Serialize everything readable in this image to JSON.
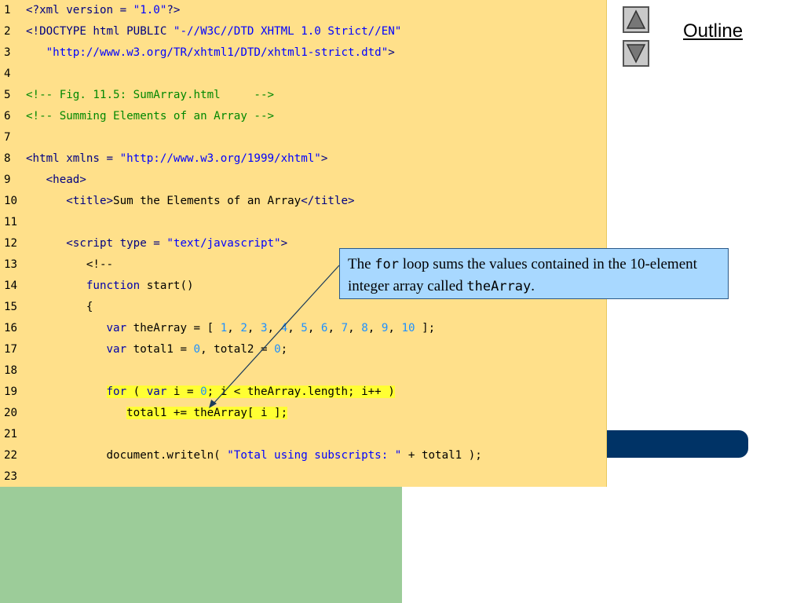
{
  "nav": {
    "outline_label": "Outline",
    "prev_icon": "triangle-up-icon",
    "next_icon": "triangle-down-icon"
  },
  "callout": {
    "part1": "The ",
    "code1": "for",
    "part2": " loop sums the values contained in the 10-element integer array called ",
    "code2": "theArray",
    "part3": "."
  },
  "code_lines": [
    {
      "num": "1",
      "text": "<?xml version = \"1.0\"?>"
    },
    {
      "num": "2",
      "text": "<!DOCTYPE html PUBLIC \"-//W3C//DTD XHTML 1.0 Strict//EN\""
    },
    {
      "num": "3",
      "text": "   \"http://www.w3.org/TR/xhtml1/DTD/xhtml1-strict.dtd\">"
    },
    {
      "num": "4",
      "text": ""
    },
    {
      "num": "5",
      "text": "<!-- Fig. 11.5: SumArray.html     -->"
    },
    {
      "num": "6",
      "text": "<!-- Summing Elements of an Array -->"
    },
    {
      "num": "7",
      "text": ""
    },
    {
      "num": "8",
      "text": "<html xmlns = \"http://www.w3.org/1999/xhtml\">"
    },
    {
      "num": "9",
      "text": "   <head>"
    },
    {
      "num": "10",
      "text": "      <title>Sum the Elements of an Array</title>"
    },
    {
      "num": "11",
      "text": ""
    },
    {
      "num": "12",
      "text": "      <script type = \"text/javascript\">"
    },
    {
      "num": "13",
      "text": "         <!--"
    },
    {
      "num": "14",
      "text": "         function start()"
    },
    {
      "num": "15",
      "text": "         {"
    },
    {
      "num": "16",
      "text": "            var theArray = [ 1, 2, 3, 4, 5, 6, 7, 8, 9, 10 ];"
    },
    {
      "num": "17",
      "text": "            var total1 = 0, total2 = 0;"
    },
    {
      "num": "18",
      "text": ""
    },
    {
      "num": "19",
      "text": "            for ( var i = 0; i < theArray.length; i++ )"
    },
    {
      "num": "20",
      "text": "               total1 += theArray[ i ];"
    },
    {
      "num": "21",
      "text": ""
    },
    {
      "num": "22",
      "text": "            document.writeln( \"Total using subscripts: \" + total1 );"
    },
    {
      "num": "23",
      "text": ""
    }
  ],
  "colors": {
    "code_background": "#ffe08a",
    "highlight": "#ffff33",
    "callout_background": "#a8d8ff",
    "green_block": "#9ccc99",
    "blue_bar": "#003366"
  }
}
